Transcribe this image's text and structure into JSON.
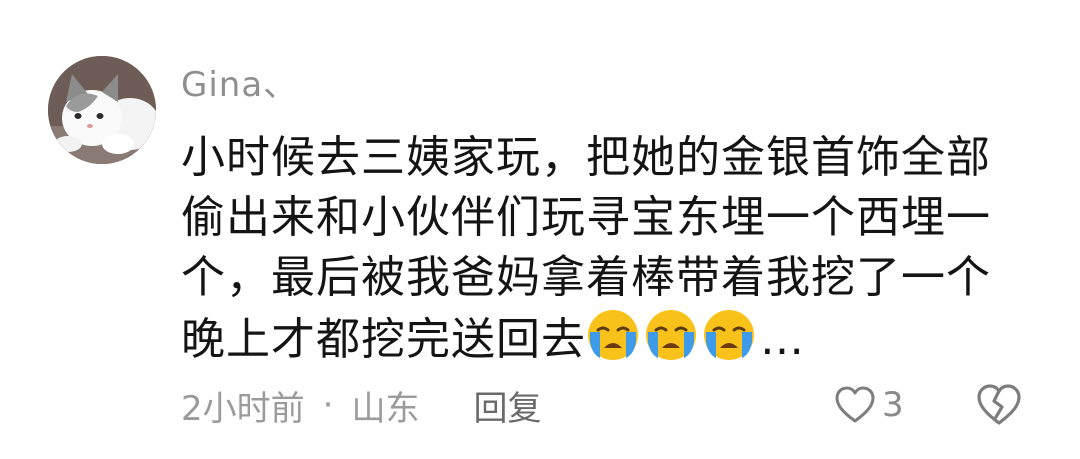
{
  "comment": {
    "author": "Gina、",
    "lines": [
      "小时候去三姨家玩，把她的金银首饰全部",
      "偷出来和小伙伴们玩寻宝东埋一个西埋一",
      "个，最后被我爸妈拿着棒带着我挖了一个",
      "晚上才都挖完送回去"
    ],
    "trailing_ellipsis": "…",
    "emojis": [
      "loudly-crying-face-icon",
      "loudly-crying-face-icon",
      "loudly-crying-face-icon"
    ],
    "time": "2小时前",
    "separator": "·",
    "location": "山东",
    "reply_label": "回复",
    "like_count": "3"
  },
  "colors": {
    "text": "#141414",
    "secondary": "#9b9b9b",
    "emoji_yellow": "#f9c21a",
    "emoji_tear": "#3d9be9"
  }
}
